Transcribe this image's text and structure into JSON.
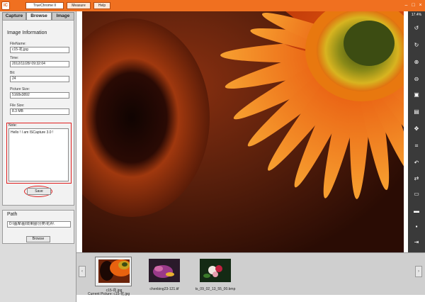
{
  "titlebar": {
    "logo": "IC",
    "app_title": "TrueChrome II",
    "menu": [
      "Measure",
      "Help"
    ]
  },
  "tabs": [
    "Capture",
    "Browse",
    "Image"
  ],
  "active_tab": "Browse",
  "image_info": {
    "section_title": "Image Information",
    "filename_label": "FileName:",
    "filename": "c15-花.jpg",
    "time_label": "Time:",
    "time": "2012/11/28/ 09:32:04",
    "bit_label": "Bit:",
    "bit": "24",
    "size_label": "Picture Size:",
    "size": "5168x3892",
    "filesize_label": "File Size:",
    "filesize": "8.3 MB",
    "note_label": "Note:",
    "note": "Hello ! I am ISCapture 3.0 !",
    "save_label": "Save"
  },
  "path": {
    "section_title": "Path",
    "value": "D:\\图库\\图\\效果图\\分类\\花卉\\",
    "browse_label": "Browse"
  },
  "toolbar": {
    "zoom": "17.4%",
    "icons": [
      "rotate-left-icon",
      "rotate-right-icon",
      "zoom-in-icon",
      "zoom-out-icon",
      "fit-icon",
      "image-icon",
      "move-icon",
      "crop-icon",
      "undo-icon",
      "flip-icon",
      "print-icon",
      "folder-icon",
      "save-icon",
      "export-icon"
    ]
  },
  "thumbnails": [
    {
      "caption": "c15-花.jpg",
      "selected": true
    },
    {
      "caption": "chenbing23-121.tif",
      "selected": false
    },
    {
      "caption": "ts_09_02_13_55_00.bmp",
      "selected": false
    }
  ],
  "status": "Current Picture: c15-花.jpg",
  "colors": {
    "titlebar": "#f07020",
    "highlight": "#e02020"
  }
}
